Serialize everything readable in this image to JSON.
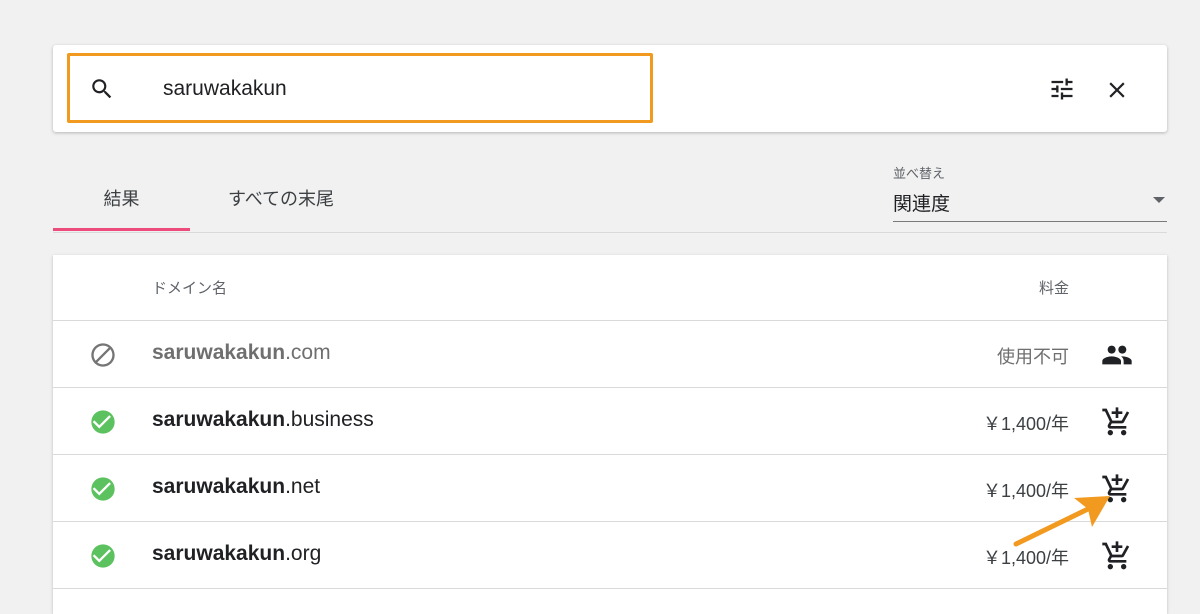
{
  "search": {
    "value": "saruwakakun",
    "icons": [
      "search-icon",
      "tune-icon",
      "close-icon"
    ]
  },
  "tabs": [
    {
      "label": "結果",
      "active": true
    },
    {
      "label": "すべての末尾",
      "active": false
    }
  ],
  "sort": {
    "label": "並べ替え",
    "value": "関連度"
  },
  "table": {
    "columns": {
      "domain": "ドメイン名",
      "price": "料金"
    },
    "rows": [
      {
        "name": "saruwakakun",
        "tld": ".com",
        "price": "使用不可",
        "status": "unavailable",
        "action_icon": "people-icon"
      },
      {
        "name": "saruwakakun",
        "tld": ".business",
        "price": "￥1,400/年",
        "status": "available",
        "action_icon": "add-to-cart-icon"
      },
      {
        "name": "saruwakakun",
        "tld": ".net",
        "price": "￥1,400/年",
        "status": "available",
        "action_icon": "add-to-cart-icon"
      },
      {
        "name": "saruwakakun",
        "tld": ".org",
        "price": "￥1,400/年",
        "status": "available",
        "action_icon": "add-to-cart-icon"
      }
    ]
  },
  "colors": {
    "highlight_border": "#f29a1f",
    "tab_indicator": "#ec4b7b",
    "available_green": "#5cc15f",
    "annotation_arrow": "#f29a1f"
  }
}
